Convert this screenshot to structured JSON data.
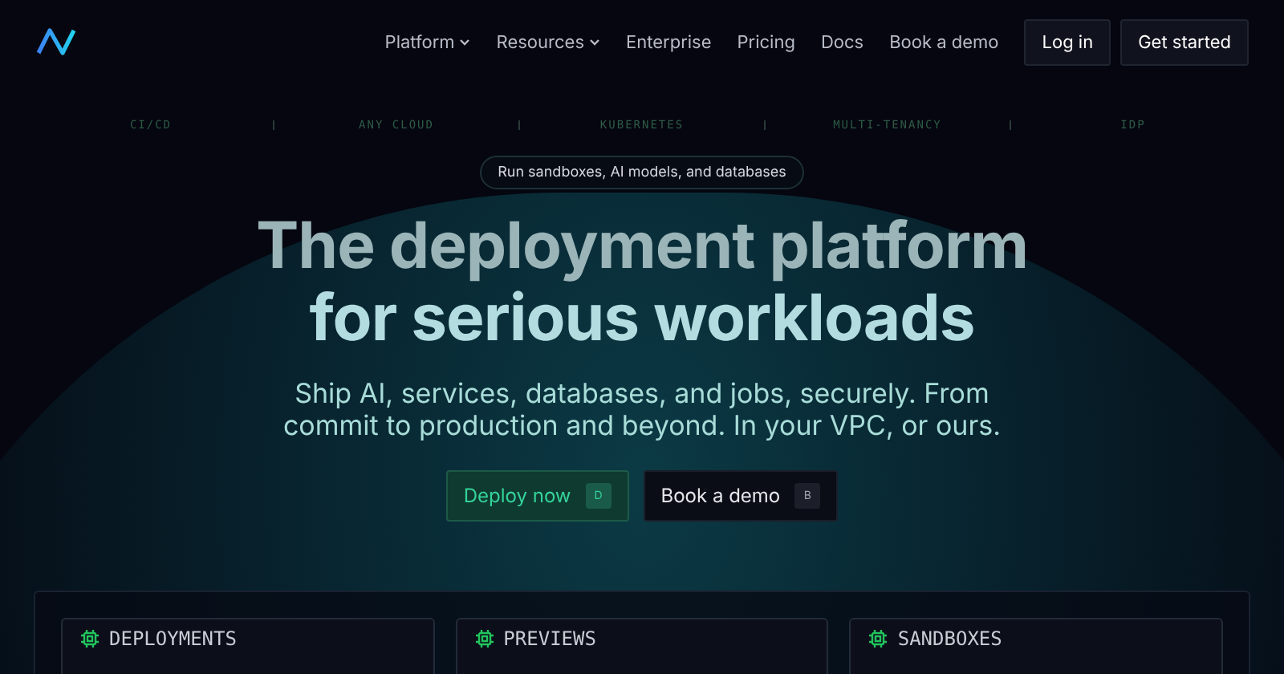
{
  "nav": {
    "links": [
      {
        "label": "Platform",
        "dropdown": true
      },
      {
        "label": "Resources",
        "dropdown": true
      },
      {
        "label": "Enterprise",
        "dropdown": false
      },
      {
        "label": "Pricing",
        "dropdown": false
      },
      {
        "label": "Docs",
        "dropdown": false
      },
      {
        "label": "Book a demo",
        "dropdown": false
      }
    ],
    "login": "Log in",
    "signup": "Get started"
  },
  "tags": [
    "CI/CD",
    "ANY CLOUD",
    "KUBERNETES",
    "MULTI-TENANCY",
    "IDP"
  ],
  "hero": {
    "pill": "Run sandboxes, AI models, and databases",
    "title_lines": [
      "The deployment platform",
      "for serious workloads"
    ],
    "subtitle": "Ship AI, services, databases, and jobs, securely. From commit to production and beyond. In your VPC, or ours.",
    "buttons": [
      {
        "kind": "primary",
        "label": "Deploy now",
        "key": "D"
      },
      {
        "kind": "secondary",
        "label": "Book a demo",
        "key": "B"
      }
    ]
  },
  "cards": [
    {
      "title": "DEPLOYMENTS"
    },
    {
      "title": "PREVIEWS"
    },
    {
      "title": "SANDBOXES"
    }
  ]
}
